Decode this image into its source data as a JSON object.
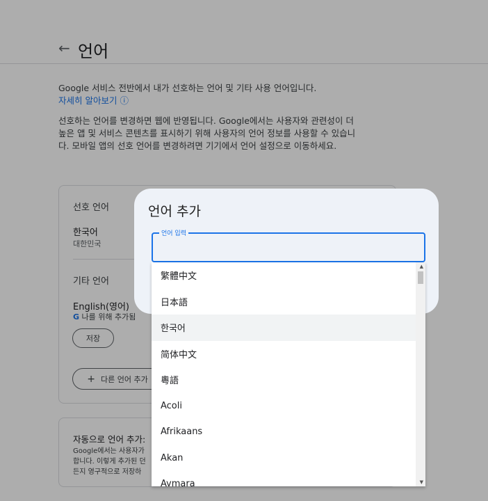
{
  "page": {
    "back_icon": "←",
    "title": "언어",
    "intro": "Google 서비스 전반에서 내가 선호하는 언어 및 기타 사용 언어입니다.",
    "learn_more": "자세히 알아보기 ⓘ",
    "description": "선호하는 언어를 변경하면 웹에 반영됩니다. Google에서는 사용자와 관련성이 더 높은 앱 및 서비스 콘텐츠를 표시하기 위해 사용자의 언어 정보를 사용할 수 있습니다. 모바일 앱의 선호 언어를 변경하려면 기기에서 언어 설정으로 이동하세요."
  },
  "preferred": {
    "section_title": "선호 언어",
    "language": "한국어",
    "region": "대한민국"
  },
  "other": {
    "section_title": "기타 언어",
    "language": "English(영어)",
    "added_note": "나를 위해 추가됨",
    "save_button": "저장",
    "add_button": "다른 언어 추가"
  },
  "auto": {
    "title": "자동으로 언어 추가:",
    "body_line1": "Google에서는 사용자가",
    "body_line2": "합니다. 이렇게 추가된 던",
    "body_line3": "든지 영구적으로 저장하"
  },
  "dialog": {
    "title": "언어 추가",
    "field_label": "언어 입력",
    "field_value": "",
    "options": [
      "繁體中文",
      "日本語",
      "한국어",
      "简体中文",
      "粵語",
      "Acoli",
      "Afrikaans",
      "Akan",
      "Aymara"
    ],
    "highlighted_index": 2
  },
  "colors": {
    "accent": "#1a73e8",
    "dialog_bg": "#eef2f8"
  }
}
